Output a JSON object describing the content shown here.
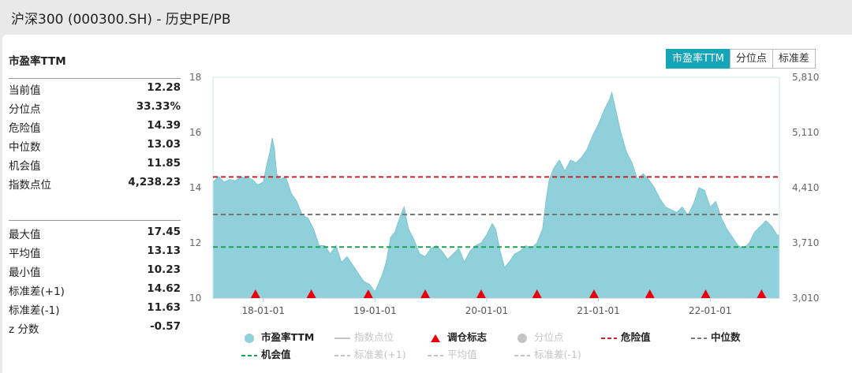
{
  "page_title": "沪深300 (000300.SH) - 历史PE/PB",
  "tabs": [
    {
      "label": "市盈率TTM",
      "active": true
    },
    {
      "label": "分位点",
      "active": false
    },
    {
      "label": "标准差",
      "active": false
    }
  ],
  "stats": {
    "title": "市盈率TTM",
    "group1": [
      {
        "label": "当前值",
        "value": "12.28"
      },
      {
        "label": "分位点",
        "value": "33.33%"
      },
      {
        "label": "危险值",
        "value": "14.39"
      },
      {
        "label": "中位数",
        "value": "13.03"
      },
      {
        "label": "机会值",
        "value": "11.85"
      },
      {
        "label": "指数点位",
        "value": "4,238.23"
      }
    ],
    "group2": [
      {
        "label": "最大值",
        "value": "17.45"
      },
      {
        "label": "平均值",
        "value": "13.13"
      },
      {
        "label": "最小值",
        "value": "10.23"
      },
      {
        "label": "标准差(+1)",
        "value": "14.62"
      },
      {
        "label": "标准差(-1)",
        "value": "11.63"
      },
      {
        "label": "z 分数",
        "value": "-0.57"
      }
    ]
  },
  "legend": [
    {
      "label": "市盈率TTM",
      "symbol": "dot",
      "color": "#8fd0da",
      "active": true
    },
    {
      "label": "指数点位",
      "symbol": "line",
      "color": "#c4c4c4",
      "active": false
    },
    {
      "label": "调仓标志",
      "symbol": "triangle",
      "color": "#e8000b",
      "active": true
    },
    {
      "label": "分位点",
      "symbol": "dot",
      "color": "#c4c4c4",
      "active": false
    },
    {
      "label": "危险值",
      "symbol": "dashed",
      "color": "#c0262b",
      "active": true
    },
    {
      "label": "中位数",
      "symbol": "dashed",
      "color": "#777777",
      "active": true
    },
    {
      "label": "机会值",
      "symbol": "dashed",
      "color": "#1fa052",
      "active": true
    },
    {
      "label": "标准差(+1)",
      "symbol": "dashed",
      "color": "#c4c4c4",
      "active": false
    },
    {
      "label": "平均值",
      "symbol": "dashed",
      "color": "#c4c4c4",
      "active": false
    },
    {
      "label": "标准差(-1)",
      "symbol": "dashed",
      "color": "#c4c4c4",
      "active": false
    }
  ],
  "chart_data": {
    "type": "area",
    "y_left": {
      "ticks": [
        "18",
        "16",
        "14",
        "12",
        "10"
      ],
      "range": [
        10,
        18
      ]
    },
    "y_right": {
      "ticks": [
        "5,810",
        "5,110",
        "4,410",
        "3,710",
        "3,010"
      ],
      "range": [
        3010,
        5810
      ]
    },
    "x_ticks": [
      {
        "label": "18-01-01",
        "x": 2018.0
      },
      {
        "label": "19-01-01",
        "x": 2019.0
      },
      {
        "label": "20-01-01",
        "x": 2020.0
      },
      {
        "label": "21-01-01",
        "x": 2021.0
      },
      {
        "label": "22-01-01",
        "x": 2022.0
      }
    ],
    "x_range": [
      2017.55,
      2022.62
    ],
    "series": [
      {
        "name": "市盈率TTM",
        "color": "#8fd0da",
        "points": [
          [
            2017.55,
            14.2
          ],
          [
            2017.6,
            14.4
          ],
          [
            2017.65,
            14.2
          ],
          [
            2017.7,
            14.3
          ],
          [
            2017.75,
            14.25
          ],
          [
            2017.8,
            14.4
          ],
          [
            2017.85,
            14.35
          ],
          [
            2017.9,
            14.3
          ],
          [
            2017.95,
            14.1
          ],
          [
            2018.0,
            14.2
          ],
          [
            2018.03,
            14.8
          ],
          [
            2018.06,
            15.3
          ],
          [
            2018.08,
            15.8
          ],
          [
            2018.1,
            15.4
          ],
          [
            2018.12,
            14.5
          ],
          [
            2018.15,
            14.3
          ],
          [
            2018.2,
            14.4
          ],
          [
            2018.25,
            13.8
          ],
          [
            2018.3,
            13.5
          ],
          [
            2018.35,
            13.0
          ],
          [
            2018.4,
            12.9
          ],
          [
            2018.45,
            12.5
          ],
          [
            2018.5,
            11.9
          ],
          [
            2018.55,
            11.9
          ],
          [
            2018.6,
            11.6
          ],
          [
            2018.65,
            11.9
          ],
          [
            2018.7,
            11.3
          ],
          [
            2018.75,
            11.5
          ],
          [
            2018.8,
            11.2
          ],
          [
            2018.85,
            10.9
          ],
          [
            2018.9,
            10.6
          ],
          [
            2018.95,
            10.5
          ],
          [
            2019.0,
            10.23
          ],
          [
            2019.03,
            10.5
          ],
          [
            2019.07,
            10.9
          ],
          [
            2019.1,
            11.3
          ],
          [
            2019.14,
            12.2
          ],
          [
            2019.18,
            12.4
          ],
          [
            2019.22,
            12.9
          ],
          [
            2019.26,
            13.3
          ],
          [
            2019.3,
            12.5
          ],
          [
            2019.35,
            12.1
          ],
          [
            2019.4,
            11.6
          ],
          [
            2019.45,
            11.5
          ],
          [
            2019.5,
            11.8
          ],
          [
            2019.55,
            11.9
          ],
          [
            2019.6,
            11.7
          ],
          [
            2019.65,
            11.4
          ],
          [
            2019.7,
            11.6
          ],
          [
            2019.75,
            11.8
          ],
          [
            2019.8,
            11.3
          ],
          [
            2019.85,
            11.7
          ],
          [
            2019.9,
            11.9
          ],
          [
            2019.95,
            12.0
          ],
          [
            2020.0,
            12.3
          ],
          [
            2020.05,
            12.7
          ],
          [
            2020.08,
            12.5
          ],
          [
            2020.12,
            11.7
          ],
          [
            2020.16,
            11.1
          ],
          [
            2020.2,
            11.3
          ],
          [
            2020.25,
            11.6
          ],
          [
            2020.3,
            11.7
          ],
          [
            2020.35,
            11.9
          ],
          [
            2020.4,
            11.8
          ],
          [
            2020.45,
            12.0
          ],
          [
            2020.5,
            12.5
          ],
          [
            2020.53,
            13.5
          ],
          [
            2020.56,
            14.3
          ],
          [
            2020.6,
            14.7
          ],
          [
            2020.65,
            15.0
          ],
          [
            2020.7,
            14.6
          ],
          [
            2020.75,
            15.0
          ],
          [
            2020.8,
            14.9
          ],
          [
            2020.85,
            15.1
          ],
          [
            2020.9,
            15.4
          ],
          [
            2020.95,
            15.9
          ],
          [
            2021.0,
            16.3
          ],
          [
            2021.05,
            16.8
          ],
          [
            2021.1,
            17.2
          ],
          [
            2021.12,
            17.45
          ],
          [
            2021.15,
            16.9
          ],
          [
            2021.2,
            16.0
          ],
          [
            2021.25,
            15.3
          ],
          [
            2021.3,
            14.9
          ],
          [
            2021.35,
            14.3
          ],
          [
            2021.4,
            14.5
          ],
          [
            2021.45,
            14.3
          ],
          [
            2021.5,
            14.0
          ],
          [
            2021.55,
            13.6
          ],
          [
            2021.6,
            13.3
          ],
          [
            2021.65,
            13.2
          ],
          [
            2021.7,
            13.1
          ],
          [
            2021.75,
            13.3
          ],
          [
            2021.8,
            13.0
          ],
          [
            2021.85,
            13.4
          ],
          [
            2021.9,
            14.0
          ],
          [
            2021.95,
            13.9
          ],
          [
            2022.0,
            13.3
          ],
          [
            2022.05,
            13.5
          ],
          [
            2022.1,
            12.9
          ],
          [
            2022.15,
            12.5
          ],
          [
            2022.2,
            12.2
          ],
          [
            2022.25,
            11.9
          ],
          [
            2022.3,
            11.8
          ],
          [
            2022.35,
            12.0
          ],
          [
            2022.4,
            12.4
          ],
          [
            2022.45,
            12.6
          ],
          [
            2022.5,
            12.8
          ],
          [
            2022.55,
            12.6
          ],
          [
            2022.6,
            12.28
          ],
          [
            2022.62,
            12.28
          ]
        ]
      }
    ],
    "reference_lines": [
      {
        "name": "危险值",
        "value": 14.39,
        "color": "#c0262b"
      },
      {
        "name": "中位数",
        "value": 13.03,
        "color": "#777777"
      },
      {
        "name": "机会值",
        "value": 11.85,
        "color": "#1fa052"
      }
    ],
    "markers": {
      "name": "调仓标志",
      "color": "#e8000b",
      "x": [
        2017.93,
        2018.43,
        2018.94,
        2019.45,
        2019.95,
        2020.45,
        2020.96,
        2021.46,
        2021.96,
        2022.46
      ]
    }
  }
}
